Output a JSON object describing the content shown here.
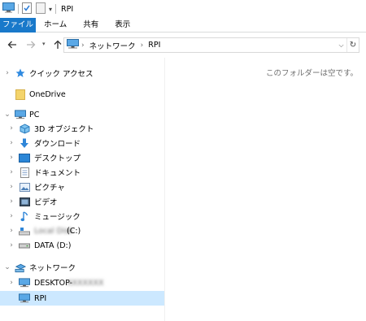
{
  "window": {
    "title": "RPI"
  },
  "ribbon": {
    "tabs": [
      "ファイル",
      "ホーム",
      "共有",
      "表示"
    ]
  },
  "address": {
    "crumbs": [
      "ネットワーク",
      "RPI"
    ]
  },
  "nav": {
    "quick_access": "クイック アクセス",
    "onedrive": "OneDrive",
    "pc": "PC",
    "objects3d": "3D オブジェクト",
    "downloads": "ダウンロード",
    "desktop": "デスクトップ",
    "documents": "ドキュメント",
    "pictures": "ピクチャ",
    "videos": "ビデオ",
    "music": "ミュージック",
    "drive_c_label": "(C:)",
    "drive_c_name_redacted": "Local Disk",
    "drive_d": "DATA (D:)",
    "network": "ネットワーク",
    "desktop_host_prefix": "DESKTOP-",
    "desktop_host_redacted": "XXXXXXX",
    "rpi": "RPI"
  },
  "content": {
    "empty_message": "このフォルダーは空です。"
  },
  "colors": {
    "file_tab": "#1979ca",
    "selection": "#cce8ff",
    "folder": "#f4d46b"
  }
}
